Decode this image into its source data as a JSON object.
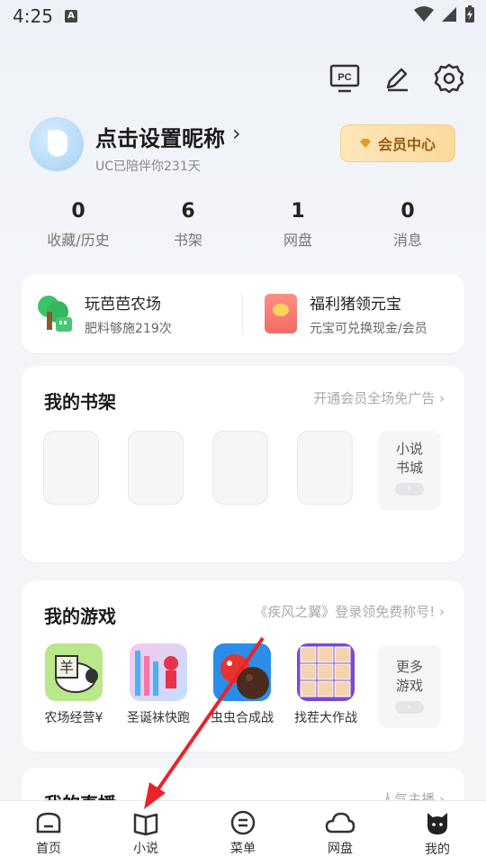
{
  "status_bar": {
    "time": "4:25",
    "notif_badge": "A"
  },
  "header_icons": [
    "pc-icon",
    "edit-icon",
    "settings-icon"
  ],
  "header": {
    "pc_label": "PC"
  },
  "profile": {
    "nickname": "点击设置昵称",
    "arrow": "›",
    "companion_text": "UC已陪伴你231天",
    "vip_button": "会员中心"
  },
  "stats": [
    {
      "num": "0",
      "label": "收藏/历史"
    },
    {
      "num": "6",
      "label": "书架"
    },
    {
      "num": "1",
      "label": "网盘"
    },
    {
      "num": "0",
      "label": "消息"
    }
  ],
  "promo": [
    {
      "title": "玩芭芭农场",
      "subtitle": "肥料够施219次"
    },
    {
      "title": "福利猪领元宝",
      "subtitle": "元宝可兑换现金/会员"
    }
  ],
  "shelf": {
    "title": "我的书架",
    "link": "开通会员全场免广告",
    "more": {
      "line1": "小说",
      "line2": "书城",
      "pill": "›"
    }
  },
  "games": {
    "title": "我的游戏",
    "link": "《疾风之翼》登录领免费称号!",
    "items": [
      {
        "name": "农场经营¥"
      },
      {
        "name": "圣诞袜快跑"
      },
      {
        "name": "虫虫合成战"
      },
      {
        "name": "找茬大作战"
      }
    ],
    "thumb_text": "羊",
    "more": {
      "line1": "更多",
      "line2": "游戏",
      "pill": "›"
    }
  },
  "live": {
    "title": "我的直播",
    "link": "人气主播"
  },
  "chevron": "›",
  "bottom_nav": [
    {
      "label": "首页"
    },
    {
      "label": "小说"
    },
    {
      "label": "菜单"
    },
    {
      "label": "网盘"
    },
    {
      "label": "我的"
    }
  ],
  "colors": {
    "accent_red": "#e8242a",
    "vip_text": "#9a5b14"
  }
}
